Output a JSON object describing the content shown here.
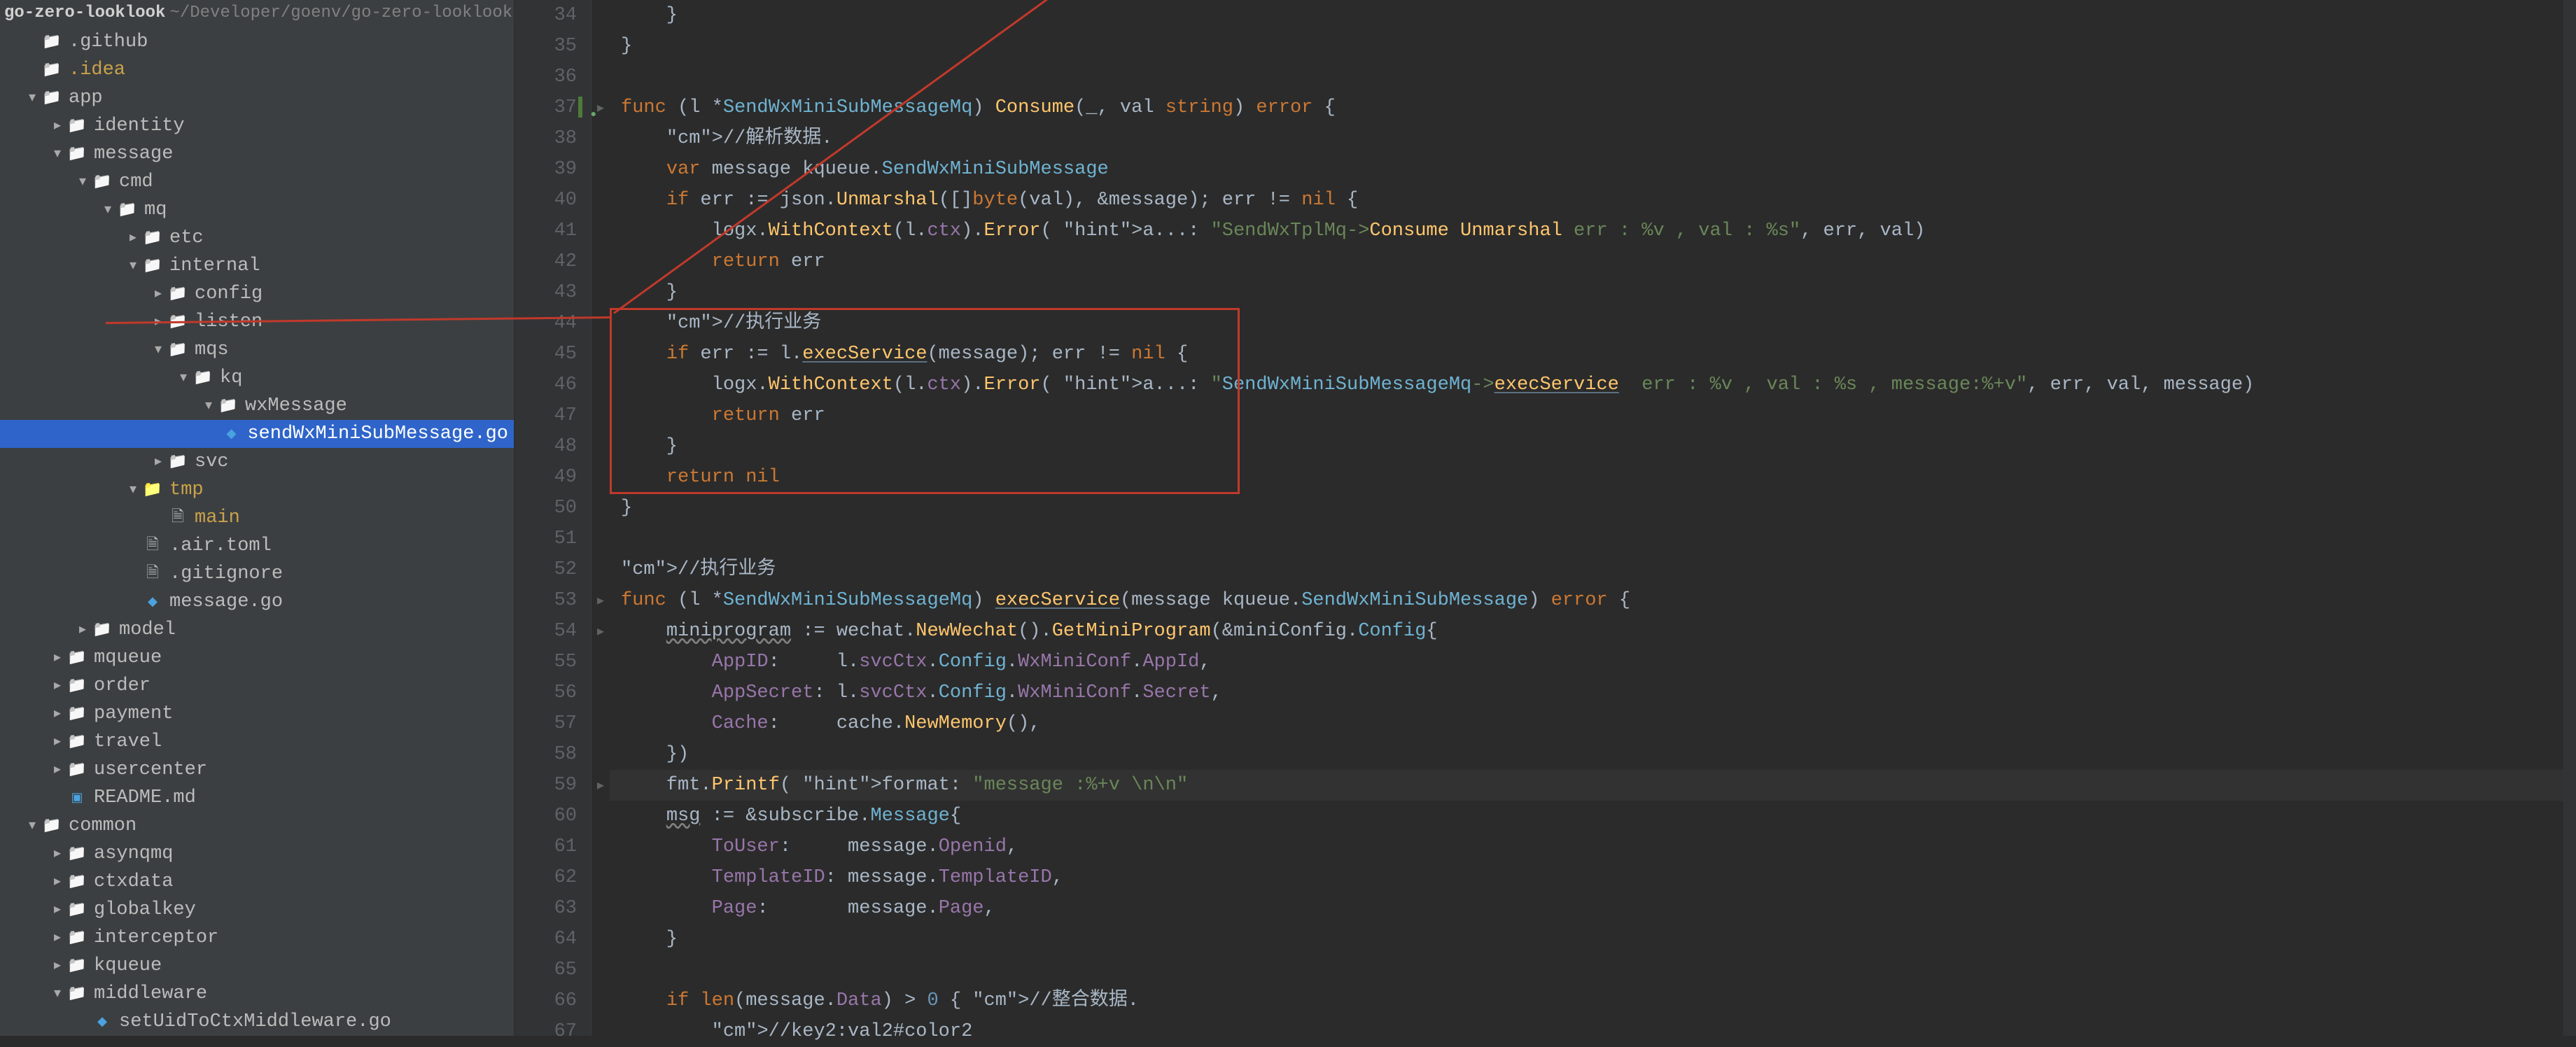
{
  "breadcrumb": {
    "root": "go-zero-looklook",
    "path": "~/Developer/goenv/go-zero-looklook"
  },
  "tree": [
    {
      "depth": 1,
      "arrow": "",
      "icon": "folder",
      "label": ".github",
      "yellow": false
    },
    {
      "depth": 1,
      "arrow": "",
      "icon": "folder",
      "label": ".idea",
      "yellow": true
    },
    {
      "depth": 1,
      "arrow": "v",
      "icon": "folder",
      "label": "app",
      "yellow": false
    },
    {
      "depth": 2,
      "arrow": ">",
      "icon": "folder",
      "label": "identity",
      "yellow": false
    },
    {
      "depth": 2,
      "arrow": "v",
      "icon": "folder",
      "label": "message",
      "yellow": false
    },
    {
      "depth": 3,
      "arrow": "v",
      "icon": "folder",
      "label": "cmd",
      "yellow": false
    },
    {
      "depth": 4,
      "arrow": "v",
      "icon": "folder",
      "label": "mq",
      "yellow": false
    },
    {
      "depth": 5,
      "arrow": ">",
      "icon": "folder",
      "label": "etc",
      "yellow": false
    },
    {
      "depth": 5,
      "arrow": "v",
      "icon": "folder",
      "label": "internal",
      "yellow": false
    },
    {
      "depth": 6,
      "arrow": ">",
      "icon": "folder",
      "label": "config",
      "yellow": false
    },
    {
      "depth": 6,
      "arrow": ">",
      "icon": "folder",
      "label": "listen",
      "yellow": false
    },
    {
      "depth": 6,
      "arrow": "v",
      "icon": "folder",
      "label": "mqs",
      "yellow": false
    },
    {
      "depth": 7,
      "arrow": "v",
      "icon": "folder",
      "label": "kq",
      "yellow": false
    },
    {
      "depth": 8,
      "arrow": "v",
      "icon": "folder",
      "label": "wxMessage",
      "yellow": false
    },
    {
      "depth": 9,
      "arrow": "",
      "icon": "go",
      "label": "sendWxMiniSubMessage.go",
      "yellow": false,
      "selected": true
    },
    {
      "depth": 6,
      "arrow": ">",
      "icon": "folder",
      "label": "svc",
      "yellow": false
    },
    {
      "depth": 5,
      "arrow": "v",
      "icon": "folder-yellow",
      "label": "tmp",
      "yellow": true
    },
    {
      "depth": 6,
      "arrow": "",
      "icon": "file",
      "label": "main",
      "yellow": true
    },
    {
      "depth": 5,
      "arrow": "",
      "icon": "file",
      "label": ".air.toml",
      "yellow": false
    },
    {
      "depth": 5,
      "arrow": "",
      "icon": "file",
      "label": ".gitignore",
      "yellow": false
    },
    {
      "depth": 5,
      "arrow": "",
      "icon": "go",
      "label": "message.go",
      "yellow": false
    },
    {
      "depth": 3,
      "arrow": ">",
      "icon": "folder",
      "label": "model",
      "yellow": false
    },
    {
      "depth": 2,
      "arrow": ">",
      "icon": "folder",
      "label": "mqueue",
      "yellow": false
    },
    {
      "depth": 2,
      "arrow": ">",
      "icon": "folder",
      "label": "order",
      "yellow": false
    },
    {
      "depth": 2,
      "arrow": ">",
      "icon": "folder",
      "label": "payment",
      "yellow": false
    },
    {
      "depth": 2,
      "arrow": ">",
      "icon": "folder",
      "label": "travel",
      "yellow": false
    },
    {
      "depth": 2,
      "arrow": ">",
      "icon": "folder",
      "label": "usercenter",
      "yellow": false
    },
    {
      "depth": 2,
      "arrow": "",
      "icon": "md",
      "label": "README.md",
      "yellow": false
    },
    {
      "depth": 1,
      "arrow": "v",
      "icon": "folder",
      "label": "common",
      "yellow": false
    },
    {
      "depth": 2,
      "arrow": ">",
      "icon": "folder",
      "label": "asynqmq",
      "yellow": false
    },
    {
      "depth": 2,
      "arrow": ">",
      "icon": "folder",
      "label": "ctxdata",
      "yellow": false
    },
    {
      "depth": 2,
      "arrow": ">",
      "icon": "folder",
      "label": "globalkey",
      "yellow": false
    },
    {
      "depth": 2,
      "arrow": ">",
      "icon": "folder",
      "label": "interceptor",
      "yellow": false
    },
    {
      "depth": 2,
      "arrow": ">",
      "icon": "folder",
      "label": "kqueue",
      "yellow": false
    },
    {
      "depth": 2,
      "arrow": "v",
      "icon": "folder",
      "label": "middleware",
      "yellow": false
    },
    {
      "depth": 3,
      "arrow": "",
      "icon": "go",
      "label": "setUidToCtxMiddleware.go",
      "yellow": false
    }
  ],
  "code": {
    "first_line": 34,
    "highlight_line": 59,
    "lines": {
      "34": "    }",
      "35": "}",
      "36": "",
      "37": "func (l *SendWxMiniSubMessageMq) Consume(_, val string) error {",
      "38": "    //解析数据.",
      "39": "    var message kqueue.SendWxMiniSubMessage",
      "40": "    if err := json.Unmarshal([]byte(val), &message); err != nil {",
      "41": "        logx.WithContext(l.ctx).Error( a...: \"SendWxTplMq->Consume Unmarshal err : %v , val : %s\", err, val)",
      "42": "        return err",
      "43": "    }",
      "44": "    //执行业务",
      "45": "    if err := l.execService(message); err != nil {",
      "46": "        logx.WithContext(l.ctx).Error( a...: \"SendWxMiniSubMessageMq->execService  err : %v , val : %s , message:%+v\", err, val, message)",
      "47": "        return err",
      "48": "    }",
      "49": "    return nil",
      "50": "}",
      "51": "",
      "52": "//执行业务",
      "53": "func (l *SendWxMiniSubMessageMq) execService(message kqueue.SendWxMiniSubMessage) error {",
      "54": "    miniprogram := wechat.NewWechat().GetMiniProgram(&miniConfig.Config{",
      "55": "        AppID:     l.svcCtx.Config.WxMiniConf.AppId,",
      "56": "        AppSecret: l.svcCtx.Config.WxMiniConf.Secret,",
      "57": "        Cache:     cache.NewMemory(),",
      "58": "    })",
      "59": "    fmt.Printf( format: \"message :%+v \\n\\n\", message)",
      "60": "    msg := &subscribe.Message{",
      "61": "        ToUser:     message.Openid,",
      "62": "        TemplateID: message.TemplateID,",
      "63": "        Page:       message.Page,",
      "64": "    }",
      "65": "",
      "66": "    if len(message.Data) > 0 { //整合数据.",
      "67": "        //key2:val2#color2"
    }
  },
  "annotation": {
    "box": {
      "top_line": 44,
      "bottom_line": 49
    }
  }
}
